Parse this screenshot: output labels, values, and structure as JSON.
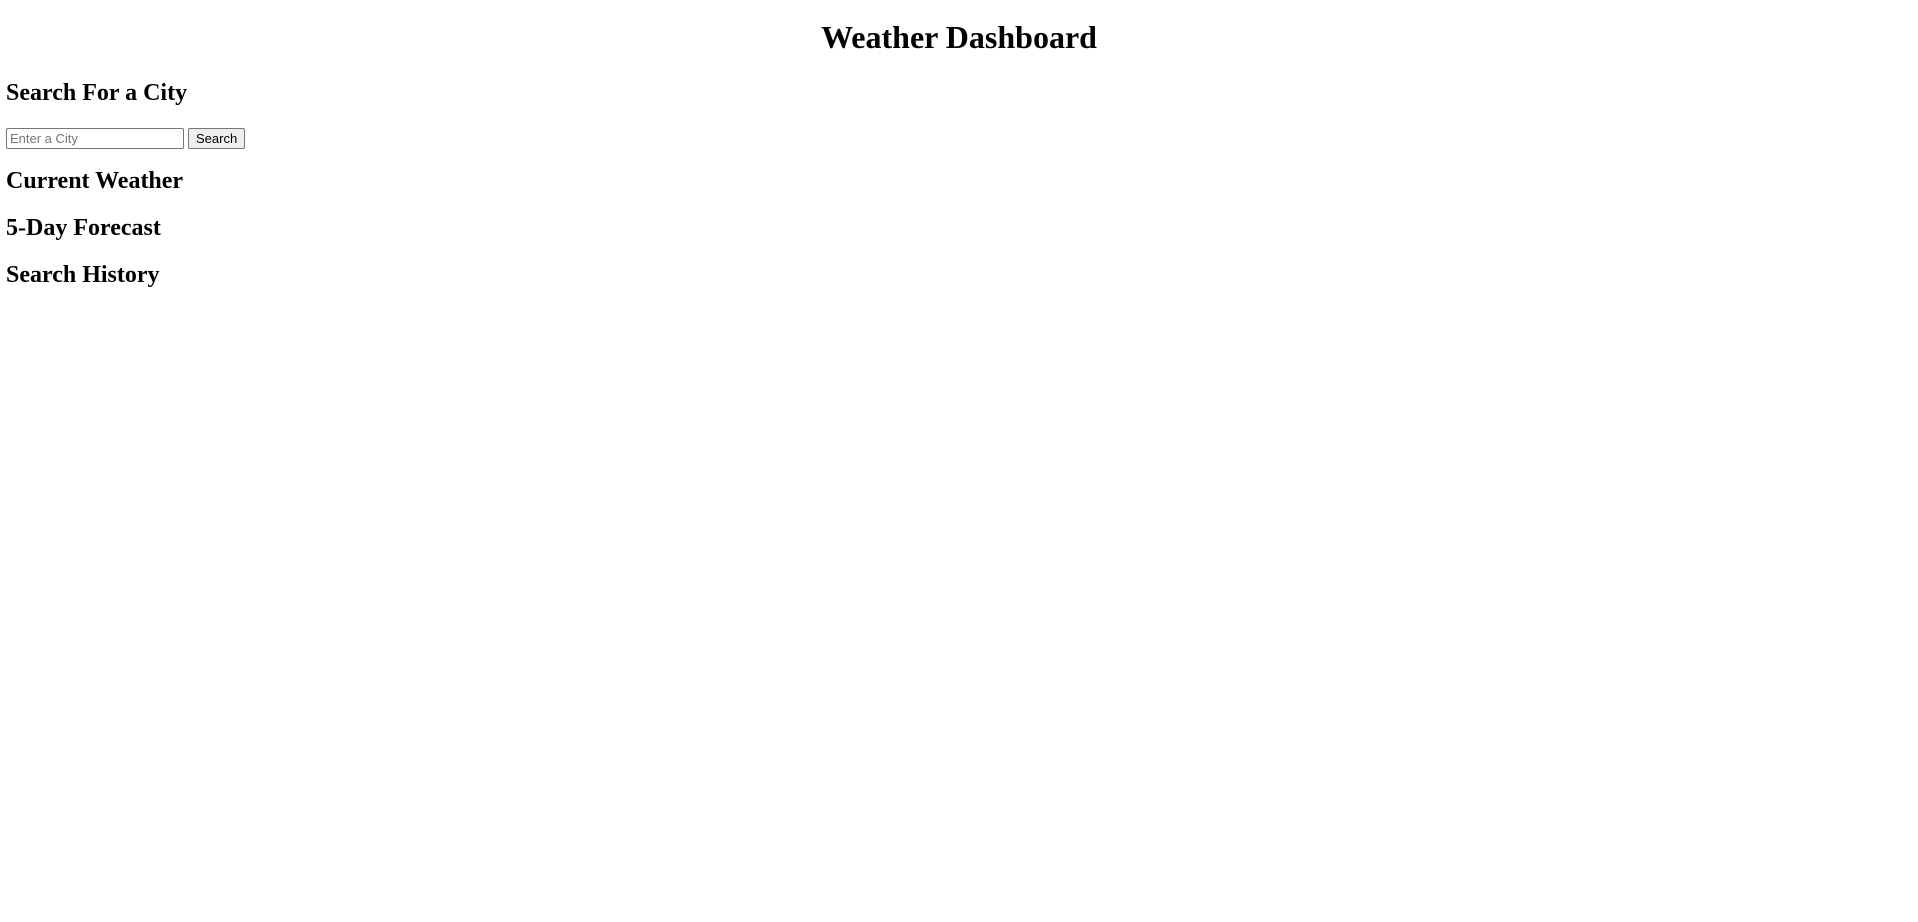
{
  "header": {
    "title": "Weather Dashboard"
  },
  "search": {
    "heading": "Search For a City",
    "input_value": "",
    "placeholder": "Enter a City",
    "button_label": "Search"
  },
  "current_weather": {
    "heading": "Current Weather"
  },
  "forecast": {
    "heading": "5-Day Forecast"
  },
  "history": {
    "heading": "Search History"
  }
}
